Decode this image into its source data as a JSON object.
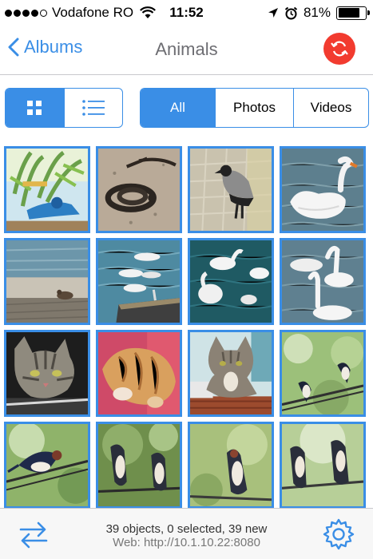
{
  "status_bar": {
    "carrier": "Vodafone RO",
    "time": "11:52",
    "battery": "81%",
    "battery_level": 0.81,
    "signal_bars": 4
  },
  "nav": {
    "back_label": "Albums",
    "title": "Animals"
  },
  "view_toggle": {
    "grid_icon": "grid-icon",
    "list_icon": "list-icon",
    "selected": "grid"
  },
  "filter": {
    "options": [
      "All",
      "Photos",
      "Videos"
    ],
    "selected": "All"
  },
  "photos": [
    {
      "subject": "parrot-branch-icon"
    },
    {
      "subject": "snake-icon"
    },
    {
      "subject": "crow-icon"
    },
    {
      "subject": "swan-icon"
    },
    {
      "subject": "bird-pier-icon"
    },
    {
      "subject": "seagulls-boat-icon"
    },
    {
      "subject": "swans-water-icon"
    },
    {
      "subject": "swans-pair-icon"
    },
    {
      "subject": "tabby-cat-icon"
    },
    {
      "subject": "ginger-cat-icon"
    },
    {
      "subject": "cat-sitting-icon"
    },
    {
      "subject": "swallows-wire-icon"
    },
    {
      "subject": "swallow-icon"
    },
    {
      "subject": "swallows-branch-icon"
    },
    {
      "subject": "swallow-perched-icon"
    },
    {
      "subject": "swallows-pair-icon"
    }
  ],
  "bottom_bar": {
    "summary": "39 objects, 0 selected, 39 new",
    "web": "Web: http://10.1.10.22:8080"
  },
  "colors": {
    "accent": "#3a8ee6",
    "sync": "#f23b2f"
  }
}
